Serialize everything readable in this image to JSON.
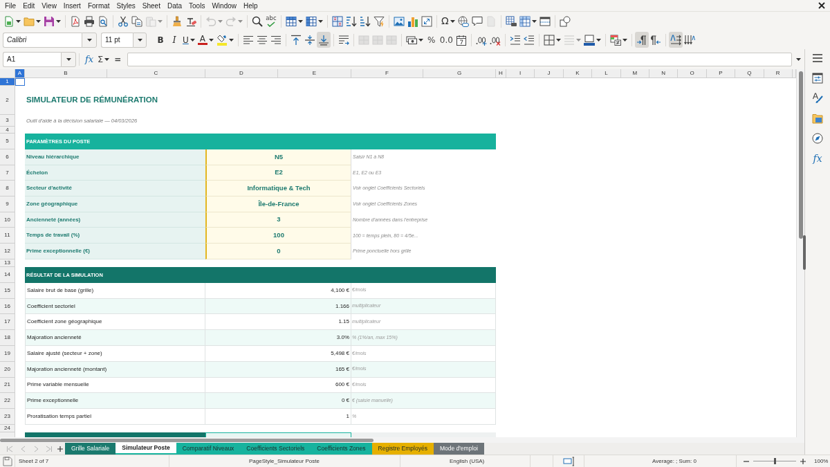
{
  "menu": [
    "File",
    "Edit",
    "View",
    "Insert",
    "Format",
    "Styles",
    "Sheet",
    "Data",
    "Tools",
    "Window",
    "Help"
  ],
  "standard_toolbar": {
    "spelling": "abc",
    "special_character": "Ω"
  },
  "formatting_toolbar": {
    "font_name": "Calibri",
    "font_size": "11 pt",
    "bold": "B",
    "italic": "I",
    "underline": "U",
    "font_color": "A",
    "percent": "%",
    "number_format": "0.0",
    "align_bottom_pressed": true,
    "left_to_right_pressed": true,
    "wrap_text_pressed": true
  },
  "formula_bar": {
    "name_box": "A1",
    "function_wizard": "fx",
    "sum": "Σ",
    "formula": "="
  },
  "column_headers": [
    {
      "label": "A",
      "selected": true
    },
    {
      "label": "B",
      "selected": false
    },
    {
      "label": "C",
      "selected": false
    },
    {
      "label": "D",
      "selected": false
    },
    {
      "label": "E",
      "selected": false
    },
    {
      "label": "F",
      "selected": false
    },
    {
      "label": "G",
      "selected": false
    },
    {
      "label": "H",
      "selected": false
    },
    {
      "label": "I",
      "selected": false
    },
    {
      "label": "J",
      "selected": false
    },
    {
      "label": "K",
      "selected": false
    },
    {
      "label": "L",
      "selected": false
    },
    {
      "label": "M",
      "selected": false
    },
    {
      "label": "N",
      "selected": false
    },
    {
      "label": "O",
      "selected": false
    },
    {
      "label": "P",
      "selected": false
    },
    {
      "label": "Q",
      "selected": false
    },
    {
      "label": "R",
      "selected": false
    }
  ],
  "row_headers": [
    {
      "label": "1",
      "selected": true
    },
    {
      "label": "2",
      "selected": false
    },
    {
      "label": "3",
      "selected": false
    },
    {
      "label": "4",
      "selected": false
    },
    {
      "label": "5",
      "selected": false
    },
    {
      "label": "6",
      "selected": false
    },
    {
      "label": "7",
      "selected": false
    },
    {
      "label": "8",
      "selected": false
    },
    {
      "label": "9",
      "selected": false
    },
    {
      "label": "10",
      "selected": false
    },
    {
      "label": "11",
      "selected": false
    },
    {
      "label": "12",
      "selected": false
    },
    {
      "label": "13",
      "selected": false
    },
    {
      "label": "14",
      "selected": false
    },
    {
      "label": "15",
      "selected": false
    },
    {
      "label": "16",
      "selected": false
    },
    {
      "label": "17",
      "selected": false
    },
    {
      "label": "18",
      "selected": false
    },
    {
      "label": "19",
      "selected": false
    },
    {
      "label": "20",
      "selected": false
    },
    {
      "label": "21",
      "selected": false
    },
    {
      "label": "22",
      "selected": false
    },
    {
      "label": "23",
      "selected": false
    },
    {
      "label": "24",
      "selected": false
    }
  ],
  "sheet": {
    "title": "SIMULATEUR DE RÉMUNÉRATION",
    "subtitle": "Outil d'aide à la décision salariale — 04/03/2026",
    "parameters": {
      "heading": "PARAMÈTRES DU POSTE",
      "rows": [
        {
          "label": "Niveau hiérarchique",
          "value": "N5",
          "note": "Saisir N1 à N8"
        },
        {
          "label": "Échelon",
          "value": "E2",
          "note": "E1, E2 ou E3"
        },
        {
          "label": "Secteur d'activité",
          "value": "Informatique & Tech",
          "note": "Voir onglet Coefficients Sectoriels"
        },
        {
          "label": "Zone géographique",
          "value": "Île-de-France",
          "note": "Voir onglet Coefficients Zones"
        },
        {
          "label": "Ancienneté (années)",
          "value": "3",
          "note": "Nombre d'années dans l'entreprise"
        },
        {
          "label": "Temps de travail (%)",
          "value": "100",
          "note": "100 = temps plein, 80 = 4/5e..."
        },
        {
          "label": "Prime exceptionnelle (€)",
          "value": "0",
          "note": "Prime ponctuelle hors grille"
        }
      ]
    },
    "results": {
      "heading": "RÉSULTAT DE LA SIMULATION",
      "rows": [
        {
          "label": "Salaire brut de base (grille)",
          "value": "4,100 €",
          "unit": "€/mois"
        },
        {
          "label": "Coefficient sectoriel",
          "value": "1.166",
          "unit": "multiplicateur"
        },
        {
          "label": "Coefficient zone géographique",
          "value": "1.15",
          "unit": "multiplicateur"
        },
        {
          "label": "Majoration ancienneté",
          "value": "3.0%",
          "unit": "% (1%/an, max 15%)"
        },
        {
          "label": "Salaire ajusté (secteur + zone)",
          "value": "5,498 €",
          "unit": "€/mois"
        },
        {
          "label": "Majoration ancienneté (montant)",
          "value": "165 €",
          "unit": "€/mois"
        },
        {
          "label": "Prime variable mensuelle",
          "value": "600 €",
          "unit": "€/mois"
        },
        {
          "label": "Prime exceptionnelle",
          "value": "0 €",
          "unit": "€ (saisie manuelle)"
        },
        {
          "label": "Proratisation temps partiel",
          "value": "1",
          "unit": "%"
        }
      ]
    }
  },
  "sheet_tabs": [
    {
      "label": "Grille Salariale",
      "color": "#1b7a6e",
      "selected": false
    },
    {
      "label": "Simulateur Poste",
      "color": "#17b39e",
      "selected": true
    },
    {
      "label": "Comparatif Niveaux",
      "color": "#17b39e",
      "selected": false
    },
    {
      "label": "Coefficients Sectoriels",
      "color": "#17b39e",
      "selected": false
    },
    {
      "label": "Coefficients Zones",
      "color": "#17b39e",
      "selected": false
    },
    {
      "label": "Registre Employés",
      "color": "#e6b000",
      "selected": false
    },
    {
      "label": "Mode d'emploi",
      "color": "#6d7479",
      "selected": false
    }
  ],
  "sidebar": {
    "functions": "fx"
  },
  "status_bar": {
    "sheet": "Sheet 2 of 7",
    "page_style": "PageStyle_Simulateur Poste",
    "language": "English (USA)",
    "selection_summary": "Average: ; Sum: 0",
    "zoom": "100%"
  },
  "zoom_slider": {
    "level": 0.5
  }
}
